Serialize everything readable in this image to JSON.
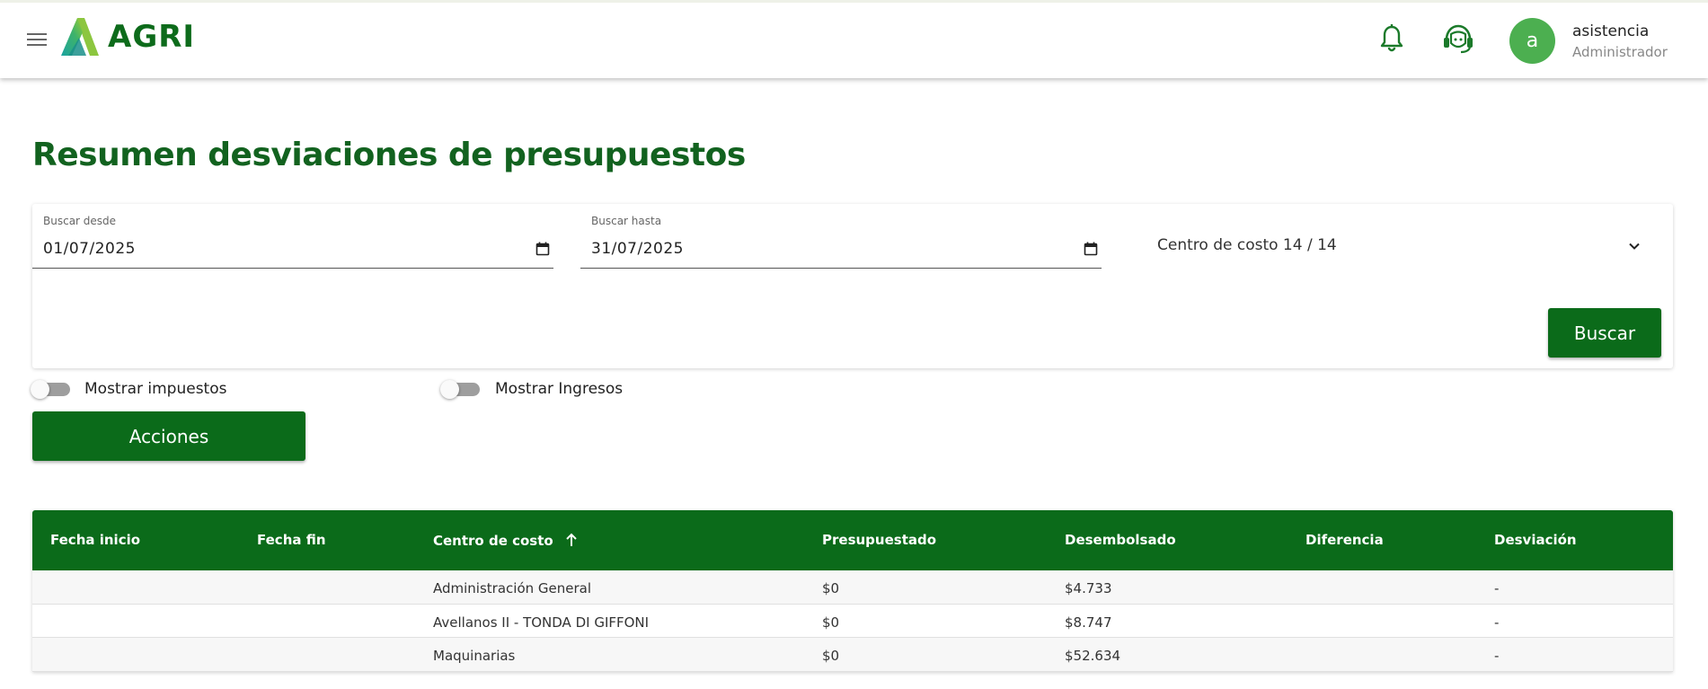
{
  "header": {
    "brand": "AGRI",
    "user": {
      "avatar_letter": "a",
      "name": "asistencia",
      "role": "Administrador"
    },
    "icons": {
      "menu": "menu-icon",
      "notifications": "bell-icon",
      "support": "headset-icon"
    }
  },
  "page": {
    "title": "Resumen desviaciones de presupuestos"
  },
  "filters": {
    "desde": {
      "label": "Buscar desde",
      "value": "01/07/2025"
    },
    "hasta": {
      "label": "Buscar hasta",
      "value": "31/07/2025"
    },
    "centro_costo": {
      "value": "Centro de costo 14 / 14"
    },
    "buscar_label": "Buscar"
  },
  "toggles": {
    "impuestos": {
      "label": "Mostrar impuestos",
      "on": false
    },
    "ingresos": {
      "label": "Mostrar Ingresos",
      "on": false
    }
  },
  "acciones_label": "Acciones",
  "table": {
    "headers": [
      "Fecha inicio",
      "Fecha fin",
      "Centro de costo",
      "Presupuestado",
      "Desembolsado",
      "Diferencia",
      "Desviación"
    ],
    "rows": [
      [
        "",
        "",
        "Administración General",
        "$0",
        "$4.733",
        "",
        "-"
      ],
      [
        "",
        "",
        "Avellanos II - TONDA DI GIFFONI",
        "$0",
        "$8.747",
        "",
        "-"
      ],
      [
        "",
        "",
        "Maquinarias",
        "$0",
        "$52.634",
        "",
        "-"
      ]
    ]
  },
  "colors": {
    "primary": "#0b6b1a",
    "title": "#12621f",
    "avatar": "#4caf50"
  }
}
